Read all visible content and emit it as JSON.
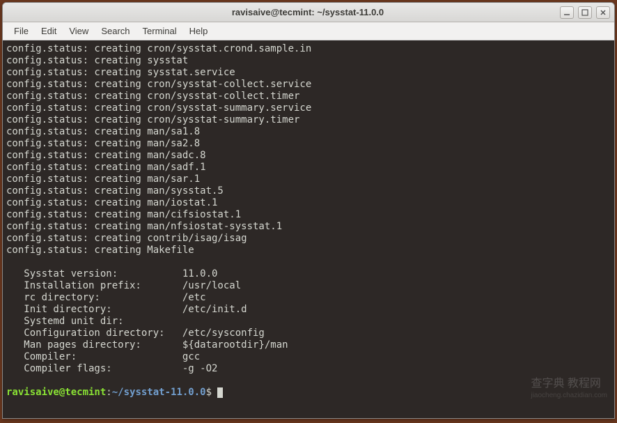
{
  "window": {
    "title": "ravisaive@tecmint: ~/sysstat-11.0.0"
  },
  "menubar": {
    "file": "File",
    "edit": "Edit",
    "view": "View",
    "search": "Search",
    "terminal": "Terminal",
    "help": "Help"
  },
  "config_lines": [
    "config.status: creating cron/sysstat.crond.sample.in",
    "config.status: creating sysstat",
    "config.status: creating sysstat.service",
    "config.status: creating cron/sysstat-collect.service",
    "config.status: creating cron/sysstat-collect.timer",
    "config.status: creating cron/sysstat-summary.service",
    "config.status: creating cron/sysstat-summary.timer",
    "config.status: creating man/sa1.8",
    "config.status: creating man/sa2.8",
    "config.status: creating man/sadc.8",
    "config.status: creating man/sadf.1",
    "config.status: creating man/sar.1",
    "config.status: creating man/sysstat.5",
    "config.status: creating man/iostat.1",
    "config.status: creating man/cifsiostat.1",
    "config.status: creating man/nfsiostat-sysstat.1",
    "config.status: creating contrib/isag/isag",
    "config.status: creating Makefile"
  ],
  "summary": [
    {
      "label": "   Sysstat version:",
      "value": "11.0.0"
    },
    {
      "label": "   Installation prefix:",
      "value": "/usr/local"
    },
    {
      "label": "   rc directory:",
      "value": "/etc"
    },
    {
      "label": "   Init directory:",
      "value": "/etc/init.d"
    },
    {
      "label": "   Systemd unit dir:",
      "value": ""
    },
    {
      "label": "   Configuration directory:",
      "value": "/etc/sysconfig"
    },
    {
      "label": "   Man pages directory:",
      "value": "${datarootdir}/man"
    },
    {
      "label": "   Compiler:",
      "value": "gcc"
    },
    {
      "label": "   Compiler flags:",
      "value": "-g -O2"
    }
  ],
  "prompt": {
    "user_host": "ravisaive@tecmint",
    "separator": ":",
    "path": "~/sysstat-11.0.0",
    "symbol": "$"
  },
  "watermark": {
    "main": "查字典 教程网",
    "sub": "jiaocheng.chazidian.com"
  }
}
